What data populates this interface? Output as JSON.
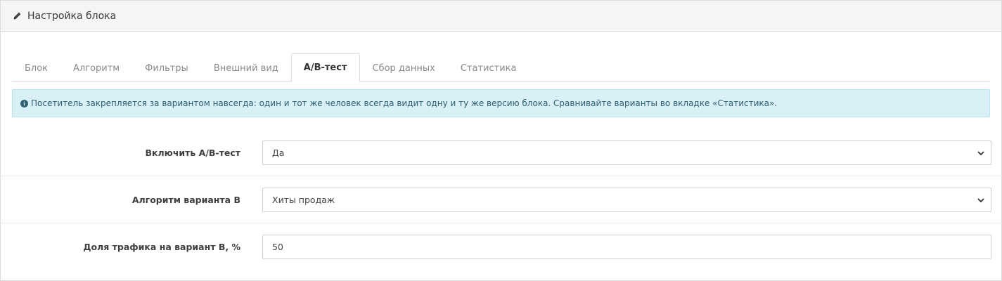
{
  "panel": {
    "title": "Настройка блока"
  },
  "tabs": [
    {
      "label": "Блок",
      "active": false
    },
    {
      "label": "Алгоритм",
      "active": false
    },
    {
      "label": "Фильтры",
      "active": false
    },
    {
      "label": "Внешний вид",
      "active": false
    },
    {
      "label": "A/B-тест",
      "active": true
    },
    {
      "label": "Сбор данных",
      "active": false
    },
    {
      "label": "Статистика",
      "active": false
    }
  ],
  "alert": {
    "text": "Посетитель закрепляется за вариантом навсегда: один и тот же человек всегда видит одну и ту же версию блока. Сравнивайте варианты во вкладке «Статистика»."
  },
  "form": {
    "enable_ab": {
      "label": "Включить A/B-тест",
      "value": "Да"
    },
    "variant_b_algorithm": {
      "label": "Алгоритм варианта B",
      "value": "Хиты продаж"
    },
    "traffic_share": {
      "label": "Доля трафика на вариант B, %",
      "value": "50"
    }
  },
  "colors": {
    "alert_bg": "#daf0f7",
    "alert_text": "#2c5f70",
    "heading_bg": "#f5f5f5"
  },
  "icons": {
    "title": "pencil-icon",
    "alert": "info-circle-icon",
    "select": "chevron-down-icon"
  }
}
